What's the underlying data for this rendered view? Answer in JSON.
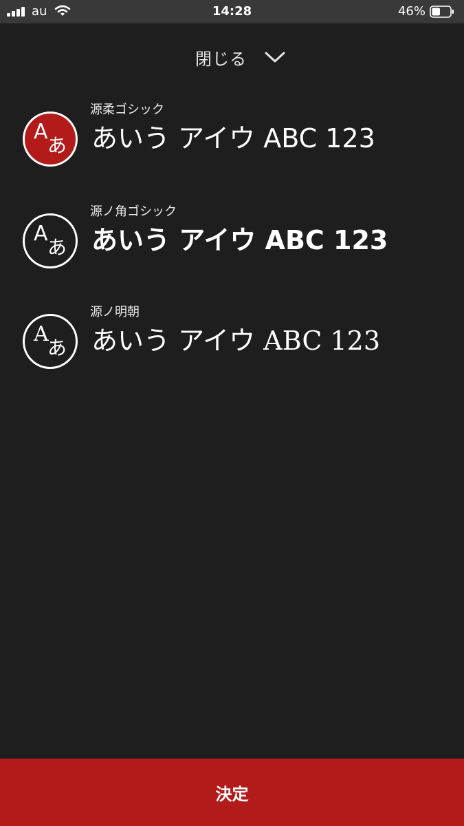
{
  "status_bar": {
    "carrier": "au",
    "time": "14:28",
    "battery_percent": "46%",
    "battery_level": 0.46,
    "signal_icon": "signal-bars-icon",
    "wifi_icon": "wifi-icon",
    "battery_icon": "battery-icon"
  },
  "header": {
    "close_label": "閉じる",
    "close_icon": "chevron-down-icon"
  },
  "fonts": [
    {
      "name": "源柔ゴシック",
      "sample": "あいう アイウ ABC 123",
      "icon": "font-aa-icon",
      "icon_glyph_latin": "A",
      "icon_glyph_kana": "あ",
      "selected": true
    },
    {
      "name": "源ノ角ゴシック",
      "sample": "あいう アイウ ABC 123",
      "icon": "font-aa-icon",
      "icon_glyph_latin": "A",
      "icon_glyph_kana": "あ",
      "selected": false
    },
    {
      "name": "源ノ明朝",
      "sample": "あいう アイウ ABC 123",
      "icon": "font-aa-icon",
      "icon_glyph_latin": "A",
      "icon_glyph_kana": "あ",
      "selected": false
    }
  ],
  "footer": {
    "confirm_label": "決定"
  },
  "colors": {
    "background": "#1f1e1f",
    "status_bar": "#3a3939",
    "accent": "#b31b1b",
    "text": "#ffffff"
  }
}
